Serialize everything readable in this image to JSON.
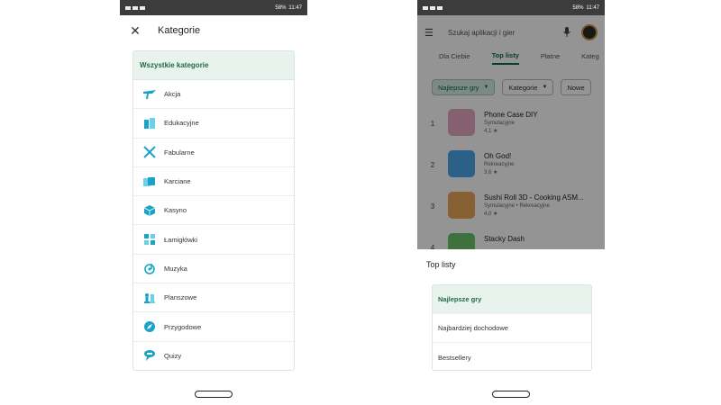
{
  "left_screen": {
    "status": {
      "battery": "58%",
      "time": "11:47"
    },
    "header": {
      "close_icon": "close-icon",
      "title": "Kategorie"
    },
    "categories": {
      "header": "Wszystkie kategorie",
      "items": [
        {
          "label": "Akcja",
          "icon": "action-icon",
          "color": "#1aa3c8"
        },
        {
          "label": "Edukacyjne",
          "icon": "education-icon",
          "color": "#1aa3c8"
        },
        {
          "label": "Fabularne",
          "icon": "swords-icon",
          "color": "#1aa3c8"
        },
        {
          "label": "Karciane",
          "icon": "cards-icon",
          "color": "#1aa3c8"
        },
        {
          "label": "Kasyno",
          "icon": "casino-icon",
          "color": "#1aa3c8"
        },
        {
          "label": "Łamigłówki",
          "icon": "puzzle-icon",
          "color": "#1aa3c8"
        },
        {
          "label": "Muzyka",
          "icon": "music-icon",
          "color": "#1aa3c8"
        },
        {
          "label": "Planszowe",
          "icon": "chess-icon",
          "color": "#1aa3c8"
        },
        {
          "label": "Przygodowe",
          "icon": "compass-icon",
          "color": "#1aa3c8"
        },
        {
          "label": "Quizy",
          "icon": "quiz-icon",
          "color": "#1aa3c8"
        }
      ]
    }
  },
  "right_screen": {
    "status": {
      "battery": "58%",
      "time": "11:47"
    },
    "search": {
      "placeholder": "Szukaj aplikacji i gier",
      "menu_icon": "menu-icon",
      "mic_icon": "mic-icon"
    },
    "tabs": [
      "Dla Ciebie",
      "Top listy",
      "Płatne",
      "Kateg"
    ],
    "active_tab": "Top listy",
    "chips": [
      "Najlepsze gry",
      "Kategorie",
      "Nowe"
    ],
    "apps": [
      {
        "rank": "1",
        "name": "Phone Case DIY",
        "category": "Symulacyjne",
        "rating": "4,1 ★",
        "color": "#e8a6c2"
      },
      {
        "rank": "2",
        "name": "Oh God!",
        "category": "Rekreacyjne",
        "rating": "3,6 ★",
        "color": "#4aa8e8"
      },
      {
        "rank": "3",
        "name": "Sushi Roll 3D - Cooking ASM...",
        "category": "Symulacyjne  •  Rekreacyjne",
        "rating": "4,0 ★",
        "color": "#e9a55a"
      },
      {
        "rank": "4",
        "name": "Stacky Dash",
        "category": "",
        "rating": "",
        "color": "#6cc36a"
      }
    ],
    "sheet": {
      "title": "Top listy",
      "options": [
        "Najlepsze gry",
        "Najbardziej dochodowe",
        "Bestsellery"
      ],
      "selected": "Najlepsze gry"
    }
  }
}
